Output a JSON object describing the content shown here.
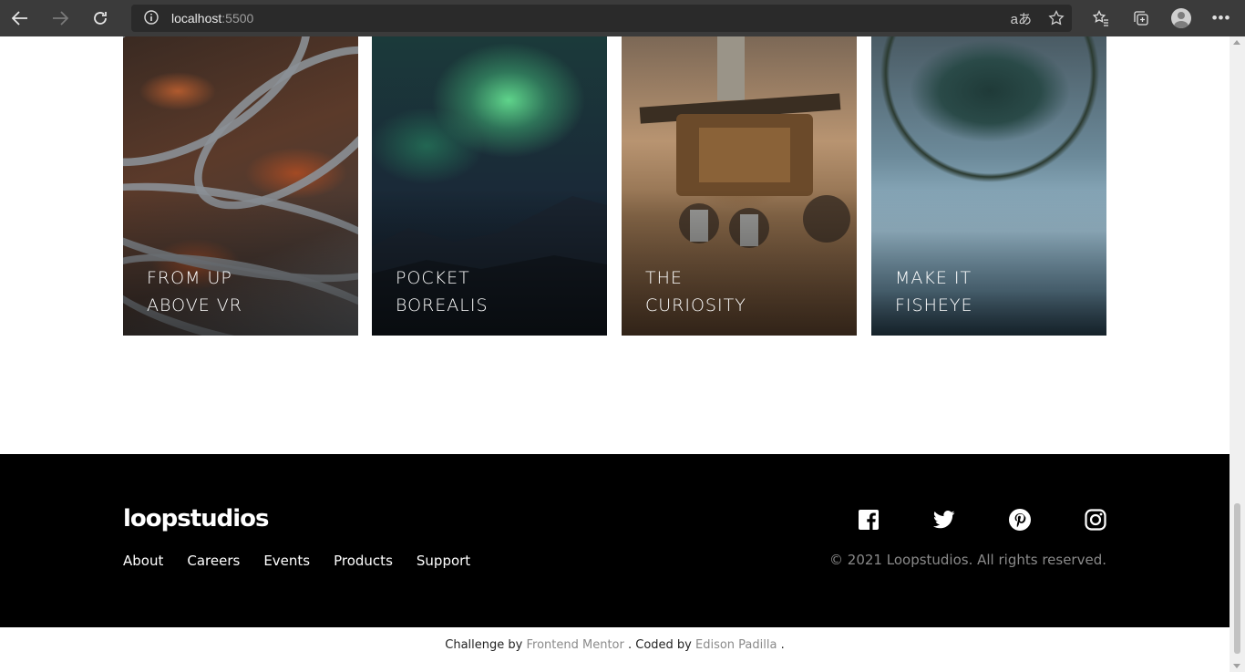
{
  "browser": {
    "url_host": "localhost",
    "url_port": ":5500"
  },
  "gallery": {
    "cards": [
      {
        "line1": "FROM UP",
        "line2": "ABOVE VR"
      },
      {
        "line1": "POCKET",
        "line2": "BOREALIS"
      },
      {
        "line1": "THE",
        "line2": "CURIOSITY"
      },
      {
        "line1": "MAKE IT",
        "line2": "FISHEYE"
      }
    ]
  },
  "footer": {
    "logo": "loopstudios",
    "nav": [
      "About",
      "Careers",
      "Events",
      "Products",
      "Support"
    ],
    "copyright": "© 2021 Loopstudios. All rights reserved.",
    "socials": [
      "facebook-icon",
      "twitter-icon",
      "pinterest-icon",
      "instagram-icon"
    ]
  },
  "attribution": {
    "prefix": "Challenge by",
    "challenge_link": "Frontend Mentor",
    "middle": ". Coded by",
    "author_link": "Edison Padilla",
    "suffix": "."
  }
}
